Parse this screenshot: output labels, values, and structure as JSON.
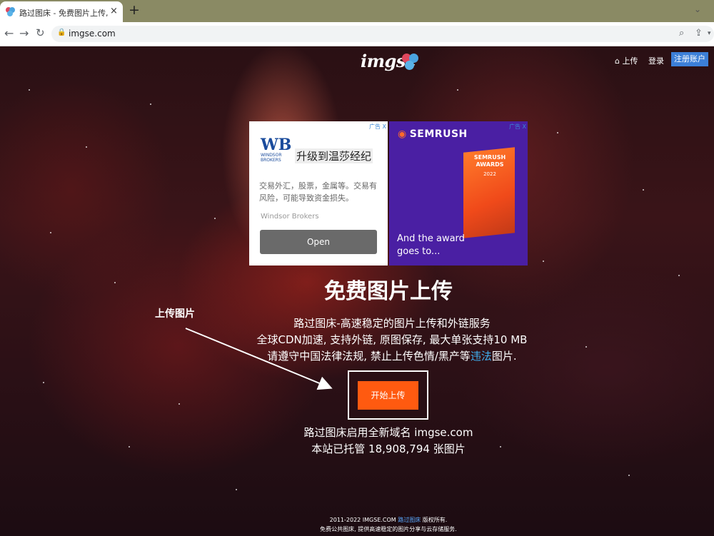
{
  "browser": {
    "tab_title": "路过图床 - 免费图片上传, 专业图",
    "tab_close": "×",
    "new_tab": "+",
    "url": "imgse.com"
  },
  "header": {
    "logo_text": "imgse",
    "upload_label": "上传",
    "login_label": "登录",
    "register_label": "注册账户"
  },
  "ads": {
    "choice_label": "广告 X",
    "windsor": {
      "logo_mark": "WB",
      "logo_sub": "WINDSOR BROKERS",
      "headline": "升级到温莎经纪",
      "body": "交易外汇，股票，金属等。交易有风险，可能导致资金损失。",
      "brand": "Windsor Brokers",
      "button": "Open"
    },
    "semrush": {
      "logo": "SEMRUSH",
      "award_title": "SEMRUSH AWARDS",
      "award_year": "2022",
      "tagline": "And the award goes to..."
    }
  },
  "hero": {
    "title": "免费图片上传",
    "line1": "路过图床-高速稳定的图片上传和外链服务",
    "line2": "全球CDN加速, 支持外链, 原图保存, 最大单张支持10 MB",
    "line3_a": "请遵守中国法律法规, 禁止上传色情/黑产等",
    "line3_link": "违法",
    "line3_b": "图片.",
    "annotation": "上传图片",
    "start_button": "开始上传",
    "domain_note": "路过图床启用全新域名 imgse.com",
    "hosted_count": "本站已托管 18,908,794 张图片"
  },
  "footer": {
    "line1_a": "2011-2022 IMGSE.COM ",
    "line1_link": "路过图床",
    "line1_b": " 版权所有.",
    "line2": "免费公共图床, 提供高速稳定的图片分享与云存储服务."
  },
  "colors": {
    "accent_orange": "#ff5a10",
    "register_blue": "#3c7fd8",
    "link_blue": "#3fb0f0"
  }
}
